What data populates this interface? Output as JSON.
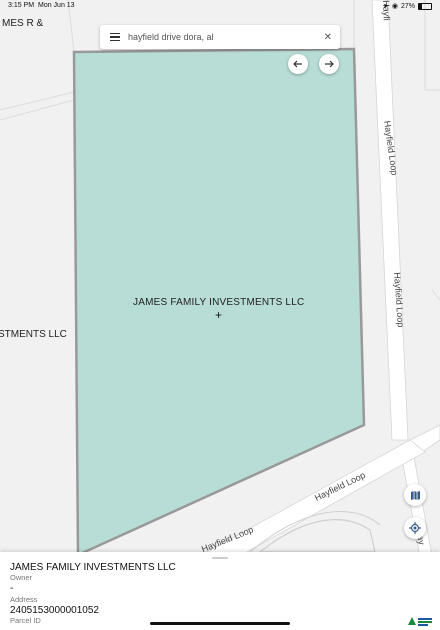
{
  "status_bar": {
    "time": "3:15 PM",
    "date": "Mon Jun 13",
    "battery": "27%"
  },
  "search": {
    "query": "hayfield drive dora, al",
    "clear_icon": "close-icon",
    "menu_icon": "menu-icon"
  },
  "nav": {
    "back_icon": "arrow-left-icon",
    "forward_icon": "arrow-right-icon"
  },
  "map": {
    "labels": {
      "top_left_owner": "MES R &",
      "left_owner": "STMENTS LLC",
      "road_vertical_1": "Hayfield Loop",
      "road_vertical_2": "Hayfield Loop",
      "road_diag_1": "Hayfield Loop",
      "road_diag_2": "Hayfield Loop",
      "road_right_partial": "Hayfi",
      "road_right_bottom": "Hay"
    },
    "parcel_label": "JAMES FAMILY INVESTMENTS LLC",
    "parcel_fill": "#b8ddd6",
    "parcel_stroke": "#999999"
  },
  "buttons": {
    "map_layers_icon": "map-icon",
    "locate_icon": "locate-icon"
  },
  "sheet": {
    "owner_value": "JAMES FAMILY INVESTMENTS LLC",
    "owner_label": "Owner",
    "address_value": "-",
    "address_label": "Address",
    "parcel_value": "2405153000001052",
    "parcel_label": "Parcel ID"
  }
}
